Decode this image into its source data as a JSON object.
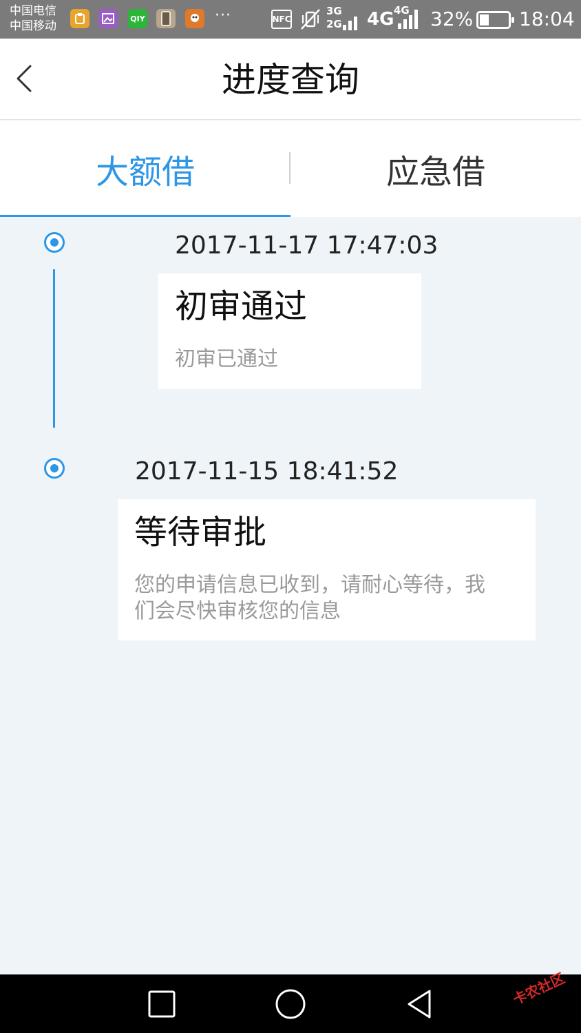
{
  "status_bar": {
    "carrier_1": "中国电信",
    "carrier_2": "中国移动",
    "icons": [
      "wallet-app-icon",
      "gallery-app-icon",
      "iqiyi-app-icon",
      "phone-app-icon",
      "game-app-icon"
    ],
    "iqiyi_label": "QIY",
    "more": "···",
    "nfc": "NFC",
    "net_3g": "3G",
    "net_2g": "2G",
    "net_4g": "4G",
    "net_4g_small": "4G",
    "battery_percent": "32%",
    "battery_level": 0.32,
    "time": "18:04"
  },
  "header": {
    "title": "进度查询"
  },
  "tabs": [
    {
      "label": "大额借",
      "active": true
    },
    {
      "label": "应急借",
      "active": false
    }
  ],
  "timeline": [
    {
      "timestamp": "2017-11-17 17:47:03",
      "title": "初审通过",
      "desc": "初审已通过"
    },
    {
      "timestamp": "2017-11-15 18:41:52",
      "title": "等待审批",
      "desc_line1": "您的申请信息已收到，请耐心等待，我",
      "desc_line2": "们会尽快审核您的信息"
    }
  ],
  "nav": {
    "buttons": [
      "recent-apps-button",
      "home-button",
      "back-nav-button"
    ]
  },
  "watermark": "卡农社区",
  "colors": {
    "accent": "#2e96e6",
    "background": "#eef4f7",
    "status_bar": "#7b7b7b"
  }
}
